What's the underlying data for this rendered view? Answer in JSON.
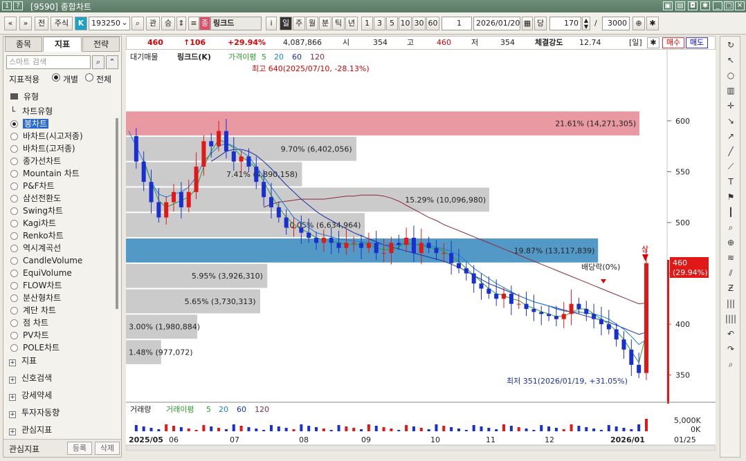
{
  "window": {
    "id": "9590",
    "title": "종합차트"
  },
  "toolbar": {
    "type_label": "전",
    "stock_label": "주식",
    "k_badge": "K",
    "code": "193250",
    "btn_gwan": "관",
    "btn_seung": "승",
    "jong_badge": "종",
    "stock_name": "링크드",
    "info_i": "i",
    "periods": [
      "일",
      "주",
      "월",
      "분",
      "틱",
      "년"
    ],
    "period_active": "일",
    "nums": [
      "1",
      "3",
      "5",
      "10",
      "30",
      "60"
    ],
    "interval": "1",
    "date": "2026/01/20",
    "dang_label": "당",
    "count": "170",
    "slash": "/",
    "max": "3000"
  },
  "leftpanel": {
    "tabs": [
      "종목",
      "지표",
      "전략"
    ],
    "active_tab": "지표",
    "search_placeholder": "스마트 검색",
    "apply_label": "지표적용",
    "opt_individual": "개별",
    "opt_all": "전체",
    "folder_type": "유형",
    "chart_type_label": "차트유형",
    "chart_types": [
      "봉차트",
      "바차트(시고저종)",
      "바차트(고저종)",
      "종가선차트",
      "Mountain 차트",
      "P&F차트",
      "삼선전환도",
      "Swing차트",
      "Kagi차트",
      "Renko차트",
      "역시계곡선",
      "CandleVolume",
      "EquiVolume",
      "FLOW차트",
      "분산형차트",
      "계단 차트",
      "점 차트",
      "PV차트",
      "POLE차트"
    ],
    "selected_chart_type": "봉차트",
    "sections": [
      "지표",
      "신호검색",
      "강세약세",
      "투자자동향",
      "관심지표"
    ],
    "bottom_label": "관심지표",
    "btn_register": "등록",
    "btn_delete": "삭제"
  },
  "header": {
    "price": "460",
    "change": "↑106",
    "pct": "+29.94%",
    "volume": "4,087,866",
    "open_label": "시",
    "open": "354",
    "high_label": "고",
    "high": "460",
    "low_label": "저",
    "low": "354",
    "strength_label": "체결강도",
    "strength": "12.74",
    "period_tag": "[일]",
    "buy_label": "매수",
    "sell_label": "매도"
  },
  "legend": {
    "main": "대기매물",
    "name": "링크드(K)",
    "ma_label": "가격이평",
    "ma_items": [
      {
        "label": "5",
        "color": "#2a9d2a"
      },
      {
        "label": "20",
        "color": "#1a7fd6"
      },
      {
        "label": "60",
        "color": "#1a2fa8"
      },
      {
        "label": "120",
        "color": "#8b2a3a"
      }
    ],
    "vol_main": "거래량",
    "vol_ma_label": "거래이평"
  },
  "annotations": {
    "high_note": "최고 640(2025/07/10, -28.13%)",
    "low_note": "최저 351(2026/01/19, +31.05%)",
    "dividend": "배당락(0%)",
    "sang": "상",
    "last_price": "460",
    "last_pct": "(29.94%)"
  },
  "chart_data": {
    "type": "candlestick",
    "ylim": [
      330,
      655
    ],
    "y_ticks": [
      350,
      400,
      450,
      500,
      550,
      600
    ],
    "x_ticks": [
      "2025/05",
      "06",
      "07",
      "08",
      "09",
      "10",
      "11",
      "12",
      "2026/01"
    ],
    "x_end_label": "01/25",
    "volume_ticks": [
      "5,000K",
      "0K"
    ],
    "volume_profile": [
      {
        "label": "21.61% (14,271,305)",
        "low": 585,
        "high": 610,
        "pct": 21.61,
        "color": "#e8939c"
      },
      {
        "label": "9.70% (6,402,056)",
        "low": 560,
        "high": 585,
        "pct": 9.7,
        "color": "#c8c8c8"
      },
      {
        "label": "7.41% (4,890,158)",
        "low": 535,
        "high": 560,
        "pct": 7.41,
        "color": "#c8c8c8"
      },
      {
        "label": "15.29% (10,096,980)",
        "low": 510,
        "high": 535,
        "pct": 15.29,
        "color": "#c8c8c8"
      },
      {
        "label": "10.05% (6,634,964)",
        "low": 485,
        "high": 510,
        "pct": 10.05,
        "color": "#c8c8c8"
      },
      {
        "label": "19.87% (13,117,839)",
        "low": 460,
        "high": 485,
        "pct": 19.87,
        "color": "#4a94c4"
      },
      {
        "label": "5.95% (3,926,310)",
        "low": 435,
        "high": 460,
        "pct": 5.95,
        "color": "#c8c8c8"
      },
      {
        "label": "5.65% (3,730,313)",
        "low": 410,
        "high": 435,
        "pct": 5.65,
        "color": "#c8c8c8"
      },
      {
        "label": "3.00% (1,980,884)",
        "low": 385,
        "high": 410,
        "pct": 3.0,
        "color": "#c8c8c8"
      },
      {
        "label": "1.48% (977,072)",
        "low": 360,
        "high": 385,
        "pct": 1.48,
        "color": "#c8c8c8"
      }
    ],
    "close_path": [
      585,
      560,
      540,
      520,
      505,
      520,
      530,
      515,
      530,
      555,
      580,
      575,
      590,
      570,
      560,
      565,
      555,
      540,
      525,
      515,
      505,
      495,
      495,
      490,
      485,
      480,
      485,
      480,
      475,
      480,
      480,
      475,
      480,
      470,
      470,
      480,
      478,
      485,
      470,
      480,
      475,
      470,
      470,
      460,
      455,
      450,
      440,
      435,
      430,
      425,
      430,
      420,
      420,
      415,
      412,
      410,
      408,
      405,
      410,
      420,
      415,
      410,
      405,
      400,
      395,
      385,
      375,
      360,
      352,
      460
    ],
    "ma20_path": [
      590,
      575,
      560,
      540,
      528,
      525,
      528,
      530,
      535,
      545,
      560,
      568,
      575,
      578,
      575,
      570,
      565,
      555,
      545,
      535,
      525,
      515,
      505,
      500,
      495,
      490,
      488,
      486,
      484,
      483,
      482,
      481,
      480,
      479,
      478,
      478,
      478,
      479,
      479,
      478,
      477,
      476,
      474,
      472,
      468,
      462,
      455,
      450,
      445,
      440,
      436,
      432,
      428,
      425,
      422,
      420,
      418,
      415,
      413,
      412,
      412,
      411,
      410,
      408,
      405,
      400,
      395,
      388,
      380,
      385
    ],
    "ma60_path": [
      null,
      null,
      null,
      null,
      null,
      null,
      null,
      null,
      null,
      null,
      null,
      560,
      565,
      570,
      572,
      572,
      570,
      566,
      560,
      553,
      545,
      537,
      530,
      523,
      517,
      511,
      506,
      502,
      498,
      494,
      490,
      487,
      484,
      481,
      478,
      476,
      474,
      472,
      470,
      468,
      466,
      464,
      462,
      459,
      456,
      452,
      448,
      444,
      440,
      437,
      434,
      431,
      428,
      425,
      422,
      420,
      418,
      416,
      414,
      412,
      410,
      408,
      406,
      404,
      402,
      399,
      396,
      393,
      390,
      392
    ],
    "ma120_path": [
      null,
      null,
      null,
      null,
      null,
      null,
      null,
      null,
      null,
      null,
      null,
      null,
      null,
      null,
      null,
      null,
      null,
      null,
      515,
      518,
      520,
      521,
      522,
      523,
      523,
      523,
      523,
      524,
      525,
      526,
      526,
      527,
      527,
      527,
      526,
      524,
      521,
      517,
      513,
      509,
      505,
      502,
      498,
      495,
      492,
      489,
      486,
      483,
      480,
      477,
      474,
      471,
      468,
      465,
      462,
      459,
      456,
      453,
      450,
      447,
      444,
      441,
      438,
      435,
      432,
      429,
      426,
      423,
      420,
      421
    ]
  }
}
